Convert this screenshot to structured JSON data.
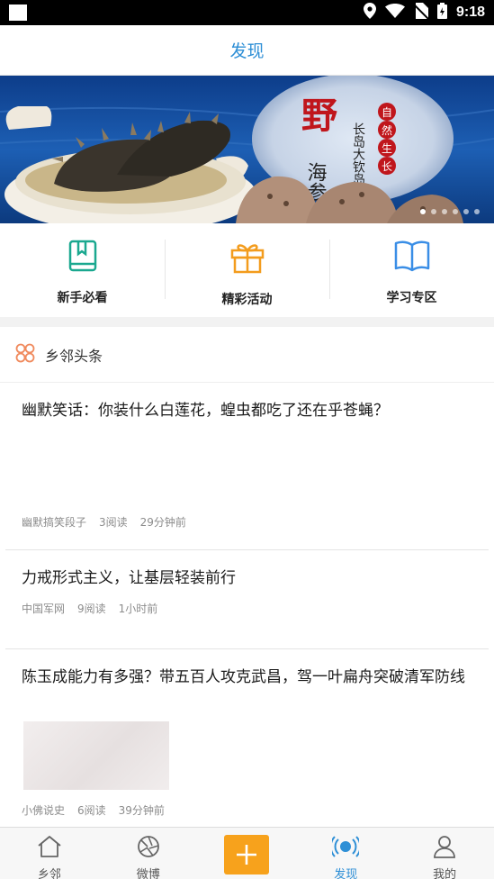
{
  "status": {
    "time": "9:18"
  },
  "header": {
    "title": "发现"
  },
  "banner": {
    "headline": "野",
    "subline": "海参",
    "side_text": "长岛大钦岛",
    "badges": [
      "自",
      "然",
      "生",
      "长"
    ],
    "dots_count": 6,
    "active_dot": 0
  },
  "quick_links": [
    {
      "label": "新手必看",
      "icon": "book-icon",
      "color": "#1aa88f"
    },
    {
      "label": "精彩活动",
      "icon": "gift-icon",
      "color": "#f39c1d"
    },
    {
      "label": "学习专区",
      "icon": "open-book-icon",
      "color": "#3a8ee6"
    }
  ],
  "section": {
    "title": "乡邻头条",
    "icon": "clover-icon",
    "icon_color": "#f08a5d"
  },
  "news": [
    {
      "title": "幽默笑话：你装什么白莲花，蝗虫都吃了还在乎苍蝇？",
      "source": "幽默搞笑段子",
      "reads": "3阅读",
      "time": "29分钟前"
    },
    {
      "title": "力戒形式主义，让基层轻装前行",
      "source": "中国军网",
      "reads": "9阅读",
      "time": "1小时前"
    },
    {
      "title": "陈玉成能力有多强？带五百人攻克武昌，驾一叶扁舟突破清军防线",
      "source": "小佛说史",
      "reads": "6阅读",
      "time": "39分钟前"
    }
  ],
  "tabs": [
    {
      "label": "乡邻",
      "icon": "house-icon"
    },
    {
      "label": "微博",
      "icon": "aperture-icon"
    },
    {
      "label": "",
      "icon": "plus-icon"
    },
    {
      "label": "发现",
      "icon": "broadcast-icon"
    },
    {
      "label": "我的",
      "icon": "person-icon"
    }
  ],
  "colors": {
    "accent": "#2e8fd6",
    "plus": "#f7a21c"
  }
}
